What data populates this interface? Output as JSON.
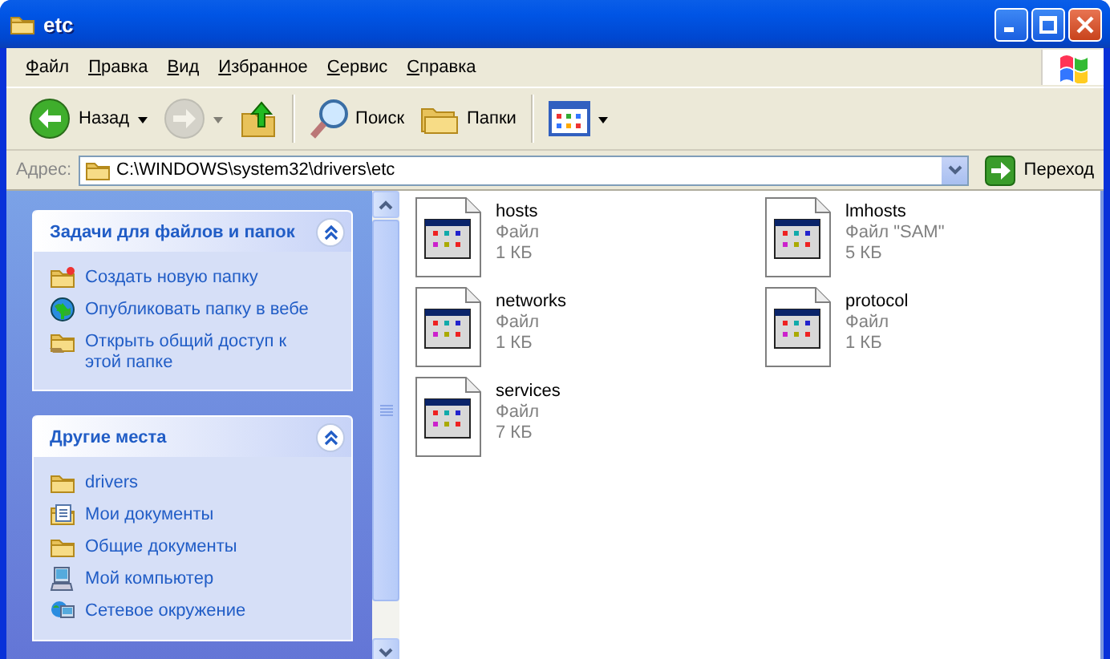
{
  "window": {
    "title": "etc"
  },
  "menu": [
    {
      "label": "Файл"
    },
    {
      "label": "Правка"
    },
    {
      "label": "Вид"
    },
    {
      "label": "Избранное"
    },
    {
      "label": "Сервис"
    },
    {
      "label": "Справка"
    }
  ],
  "toolbar": [
    {
      "kind": "back",
      "label": "Назад",
      "disabled": false
    },
    {
      "kind": "forward",
      "disabled": true
    },
    {
      "kind": "up",
      "disabled": false
    },
    {
      "kind": "search",
      "label": "Поиск",
      "disabled": false
    },
    {
      "kind": "folders",
      "label": "Папки",
      "disabled": false
    },
    {
      "kind": "views",
      "disabled": false
    }
  ],
  "address": {
    "label": "Адрес:",
    "value": "C:\\WINDOWS\\system32\\drivers\\etc",
    "go": "Переход"
  },
  "task_panes": [
    {
      "title": "Задачи для файлов и папок",
      "expanded": true,
      "items": [
        {
          "kind": "new-folder",
          "label": "Создать новую папку"
        },
        {
          "kind": "publish",
          "label": "Опубликовать папку в вебе"
        },
        {
          "kind": "share",
          "label": "Открыть общий доступ к этой папке"
        }
      ]
    },
    {
      "title": "Другие места",
      "expanded": true,
      "items": [
        {
          "kind": "folder",
          "label": "drivers"
        },
        {
          "kind": "documents",
          "label": "Мои документы"
        },
        {
          "kind": "folder",
          "label": "Общие документы"
        },
        {
          "kind": "computer",
          "label": "Мой компьютер"
        },
        {
          "kind": "network",
          "label": "Сетевое окружение"
        }
      ]
    }
  ],
  "files": [
    {
      "name": "hosts",
      "type": "Файл",
      "size": "1 КБ"
    },
    {
      "name": "lmhosts",
      "type": "Файл \"SAM\"",
      "size": "5 КБ"
    },
    {
      "name": "networks",
      "type": "Файл",
      "size": "1 КБ"
    },
    {
      "name": "protocol",
      "type": "Файл",
      "size": "1 КБ"
    },
    {
      "name": "services",
      "type": "Файл",
      "size": "7 КБ"
    }
  ]
}
